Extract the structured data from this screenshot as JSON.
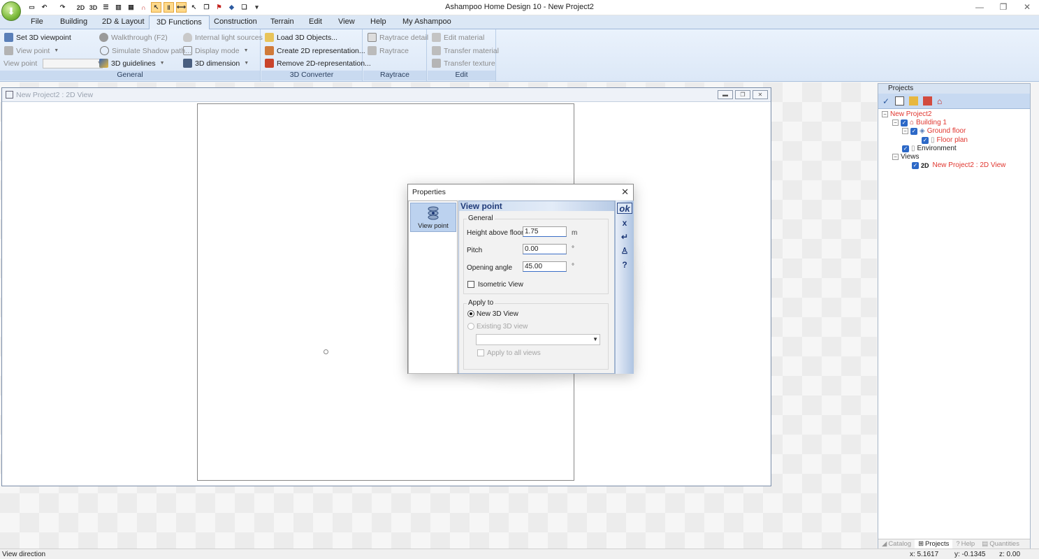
{
  "window": {
    "title": "Ashampoo Home Design 10 - New Project2",
    "controls": [
      "minimize",
      "restore",
      "close"
    ]
  },
  "quick_access": {
    "buttons": [
      "new-icon",
      "undo-icon",
      "redo-icon",
      "2D",
      "3D",
      "wall-icon",
      "window-icon",
      "grid-icon",
      "magnet-icon",
      "select-icon",
      "snap-icon",
      "dimension-icon",
      "pointer-icon",
      "copy-icon",
      "flag-icon",
      "eraser-icon",
      "paste-icon"
    ]
  },
  "menu_tabs": [
    "File",
    "Building",
    "2D & Layout",
    "3D Functions",
    "Construction",
    "Terrain",
    "Edit",
    "View",
    "Help",
    "My Ashampoo"
  ],
  "active_tab": "3D Functions",
  "ribbon": {
    "general": {
      "label": "General",
      "set_viewpoint": "Set 3D viewpoint",
      "view_point_menu": "View point",
      "view_point_field_label": "View point",
      "walkthrough": "Walkthrough (F2)",
      "simulate_shadow": "Simulate Shadow path...",
      "guidelines": "3D guidelines",
      "internal_light": "Internal light sources",
      "display_mode": "Display mode",
      "dimension": "3D dimension"
    },
    "converter": {
      "label": "3D Converter",
      "load": "Load 3D Objects...",
      "create_2d": "Create 2D representation...",
      "remove_2d": "Remove 2D-representation..."
    },
    "raytrace": {
      "label": "Raytrace",
      "detail": "Raytrace detail",
      "raytrace": "Raytrace"
    },
    "edit": {
      "label": "Edit",
      "edit_material": "Edit material",
      "transfer_material": "Transfer material",
      "transfer_texture": "Transfer texture"
    }
  },
  "document": {
    "title": "New Project2 : 2D View"
  },
  "projects_panel": {
    "title": "Projects",
    "tree": {
      "project": "New Project2",
      "building": "Building 1",
      "floor": "Ground floor",
      "floor_plan": "Floor plan",
      "environment": "Environment",
      "views": "Views",
      "view_2d_prefix": "2D",
      "view_2d": "New Project2 : 2D View"
    },
    "tabs": [
      "Catalog",
      "Projects",
      "Help",
      "Quantities"
    ],
    "active_tab": "Projects"
  },
  "dialog": {
    "title": "Properties",
    "list_item": "View point",
    "heading": "View point",
    "general_group": "General",
    "height_label": "Height above floor",
    "height_value": "1.75",
    "height_unit": "m",
    "pitch_label": "Pitch",
    "pitch_value": "0.00",
    "pitch_unit": "°",
    "angle_label": "Opening angle",
    "angle_value": "45.00",
    "angle_unit": "°",
    "isometric_label": "Isometric View",
    "isometric_checked": false,
    "apply_group": "Apply to",
    "new_3d_label": "New 3D View",
    "existing_3d_label": "Existing 3D view",
    "existing_view_value": "",
    "apply_all_label": "Apply to all views",
    "side_buttons": {
      "ok": "ok",
      "cancel": "x"
    }
  },
  "status": {
    "message": "View direction",
    "x": "x: 5.1617",
    "y": "y: -0.1345",
    "z": "z: 0.00"
  },
  "colors": {
    "ribbon_bg": "#dce8f7",
    "tree_red": "#e0362f",
    "dialog_heading": "#1f3a78",
    "checkbox_blue": "#2c68c7"
  }
}
